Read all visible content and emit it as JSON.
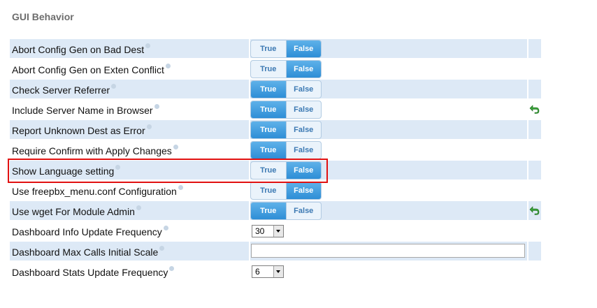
{
  "section": {
    "title": "GUI Behavior"
  },
  "toggle_labels": {
    "true": "True",
    "false": "False"
  },
  "settings": [
    {
      "label": "Abort Config Gen on Bad Dest",
      "type": "toggle",
      "value": false,
      "revert": false
    },
    {
      "label": "Abort Config Gen on Exten Conflict",
      "type": "toggle",
      "value": false,
      "revert": false
    },
    {
      "label": "Check Server Referrer",
      "type": "toggle",
      "value": true,
      "revert": false
    },
    {
      "label": "Include Server Name in Browser",
      "type": "toggle",
      "value": true,
      "revert": true
    },
    {
      "label": "Report Unknown Dest as Error",
      "type": "toggle",
      "value": true,
      "revert": false
    },
    {
      "label": "Require Confirm with Apply Changes",
      "type": "toggle",
      "value": true,
      "revert": false
    },
    {
      "label": "Show Language setting",
      "type": "toggle",
      "value": false,
      "revert": false,
      "highlighted": true
    },
    {
      "label": "Use freepbx_menu.conf Configuration",
      "type": "toggle",
      "value": false,
      "revert": false
    },
    {
      "label": "Use wget For Module Admin",
      "type": "toggle",
      "value": true,
      "revert": true
    },
    {
      "label": "Dashboard Info Update Frequency",
      "type": "select",
      "value": "30",
      "revert": false
    },
    {
      "label": "Dashboard Max Calls Initial Scale",
      "type": "text",
      "value": "",
      "revert": false
    },
    {
      "label": "Dashboard Stats Update Frequency",
      "type": "select",
      "value": "6",
      "revert": false
    }
  ],
  "icons": {
    "help": "help-icon",
    "revert": "undo-icon"
  },
  "colors": {
    "highlight": "#e11111",
    "active_toggle": "#2e8ed6",
    "row_shade": "#dde9f6"
  }
}
